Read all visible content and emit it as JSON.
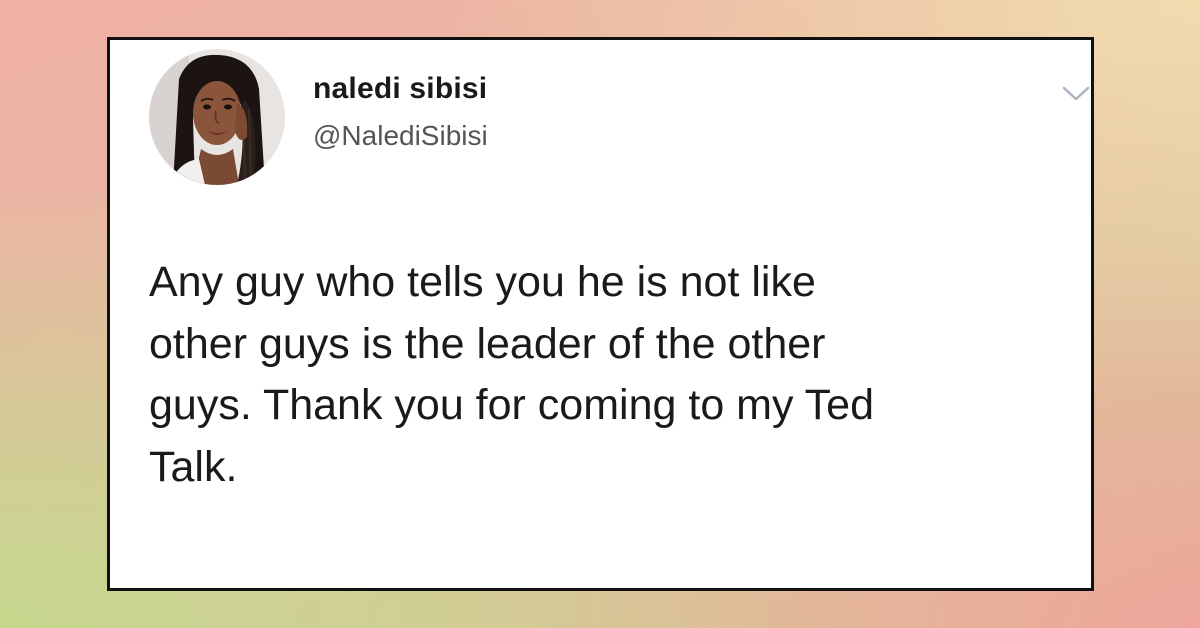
{
  "tweet": {
    "author": {
      "display_name": "naledi sibisi",
      "handle": "@NalediSibisi",
      "avatar_icon": "profile-photo"
    },
    "menu_icon": "chevron-down-icon",
    "lines": [
      "Any guy who tells you he is not like",
      "other guys is the leader of the other",
      "guys. Thank you for coming to my Ted",
      "Talk."
    ]
  },
  "colors": {
    "card_background": "#ffffff",
    "card_border": "#111111",
    "text_primary": "#1a1a1a",
    "text_secondary": "#555555",
    "chevron": "#aab4bf"
  }
}
